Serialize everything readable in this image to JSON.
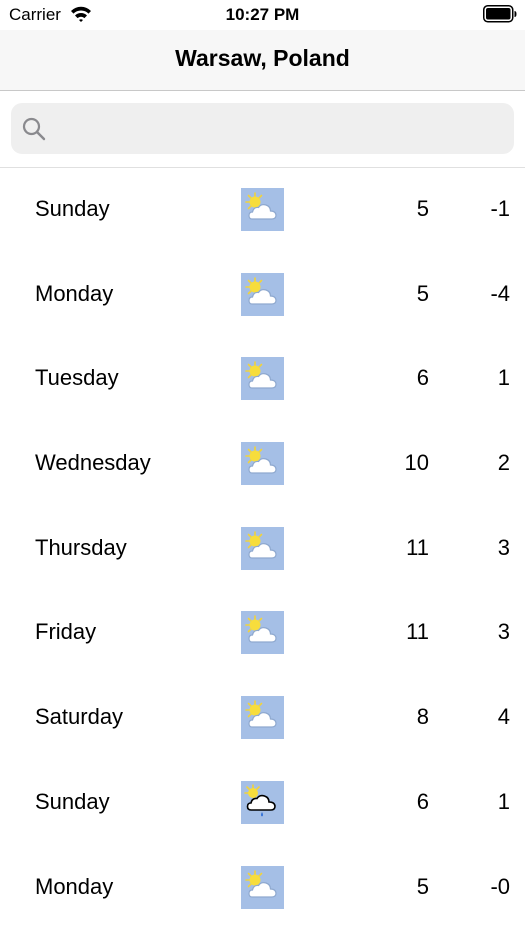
{
  "status_bar": {
    "carrier": "Carrier",
    "time": "10:27 PM"
  },
  "nav": {
    "title": "Warsaw, Poland"
  },
  "search": {
    "placeholder": "",
    "value": ""
  },
  "forecast": [
    {
      "day": "Sunday",
      "icon": "partly-cloudy-icon",
      "high": "5",
      "low": "-1"
    },
    {
      "day": "Monday",
      "icon": "partly-cloudy-icon",
      "high": "5",
      "low": "-4"
    },
    {
      "day": "Tuesday",
      "icon": "partly-cloudy-icon",
      "high": "6",
      "low": "1"
    },
    {
      "day": "Wednesday",
      "icon": "partly-cloudy-icon",
      "high": "10",
      "low": "2"
    },
    {
      "day": "Thursday",
      "icon": "partly-cloudy-icon",
      "high": "11",
      "low": "3"
    },
    {
      "day": "Friday",
      "icon": "partly-cloudy-icon",
      "high": "11",
      "low": "3"
    },
    {
      "day": "Saturday",
      "icon": "partly-cloudy-icon",
      "high": "8",
      "low": "4"
    },
    {
      "day": "Sunday",
      "icon": "rain-icon",
      "high": "6",
      "low": "1"
    },
    {
      "day": "Monday",
      "icon": "partly-cloudy-icon",
      "high": "5",
      "low": "-0"
    }
  ],
  "colors": {
    "icon_background": "#a5bfe6",
    "nav_background": "#f7f7f7",
    "search_background": "#efefef"
  }
}
